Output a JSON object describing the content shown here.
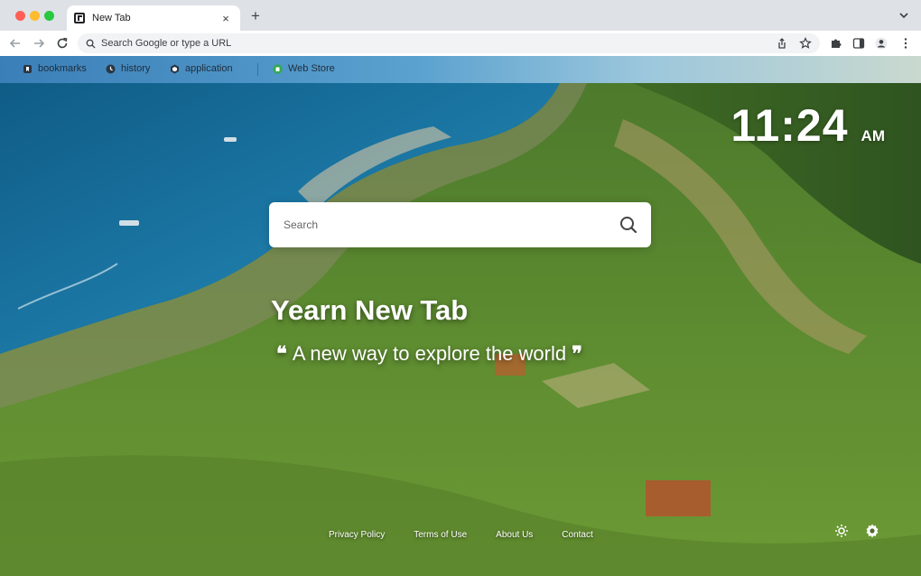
{
  "browser": {
    "tab": {
      "title": "New Tab",
      "close": "×"
    },
    "new_tab": "+",
    "omnibox": {
      "placeholder": "Search Google or type a URL"
    }
  },
  "bookmarks": [
    {
      "label": "bookmarks",
      "icon": "bookmark-icon"
    },
    {
      "label": "history",
      "icon": "history-icon"
    },
    {
      "label": "application",
      "icon": "application-icon"
    },
    {
      "label": "Web Store",
      "icon": "web-store-icon"
    }
  ],
  "clock": {
    "time": "11:24",
    "ampm": "AM"
  },
  "search": {
    "placeholder": "Search"
  },
  "brand": {
    "title": "Yearn New Tab",
    "tagline": "A new way to explore the world",
    "open_quote": "❝",
    "close_quote": "❞"
  },
  "footer": {
    "links": [
      "Privacy Policy",
      "Terms of Use",
      "About Us",
      "Contact"
    ]
  },
  "colors": {
    "sea": "#1b6f9c",
    "hillside": "#4f7d2a",
    "web_store_accent": "#34a853"
  }
}
